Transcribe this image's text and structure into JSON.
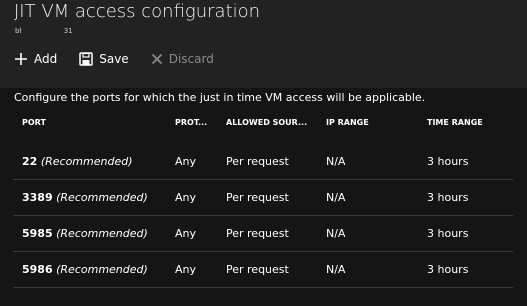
{
  "header": {
    "title": "JIT VM access configuration",
    "subtitle": "bł                   31"
  },
  "toolbar": {
    "add_label": "Add",
    "save_label": "Save",
    "discard_label": "Discard"
  },
  "main": {
    "description": "Configure the ports for which the just in time VM access will be applicable."
  },
  "table": {
    "headers": {
      "port": "PORT",
      "protocol": "PROT...",
      "allowed_source": "ALLOWED SOUR...",
      "ip_range": "IP RANGE",
      "time_range": "TIME RANGE"
    },
    "rows": [
      {
        "port": "22",
        "note": "(Recommended)",
        "protocol": "Any",
        "source": "Per request",
        "ip": "N/A",
        "time": "3 hours"
      },
      {
        "port": "3389",
        "note": "(Recommended)",
        "protocol": "Any",
        "source": "Per request",
        "ip": "N/A",
        "time": "3 hours"
      },
      {
        "port": "5985",
        "note": "(Recommended)",
        "protocol": "Any",
        "source": "Per request",
        "ip": "N/A",
        "time": "3 hours"
      },
      {
        "port": "5986",
        "note": "(Recommended)",
        "protocol": "Any",
        "source": "Per request",
        "ip": "N/A",
        "time": "3 hours"
      }
    ]
  },
  "icons": {
    "add": "plus-icon",
    "save": "floppy-disk-icon",
    "discard": "x-icon",
    "row_more": "ellipsis-icon"
  },
  "colors": {
    "background": "#151515",
    "header_background": "#222222",
    "text": "#ffffff",
    "disabled": "#8a8a8a",
    "divider": "#3a3a3a"
  }
}
